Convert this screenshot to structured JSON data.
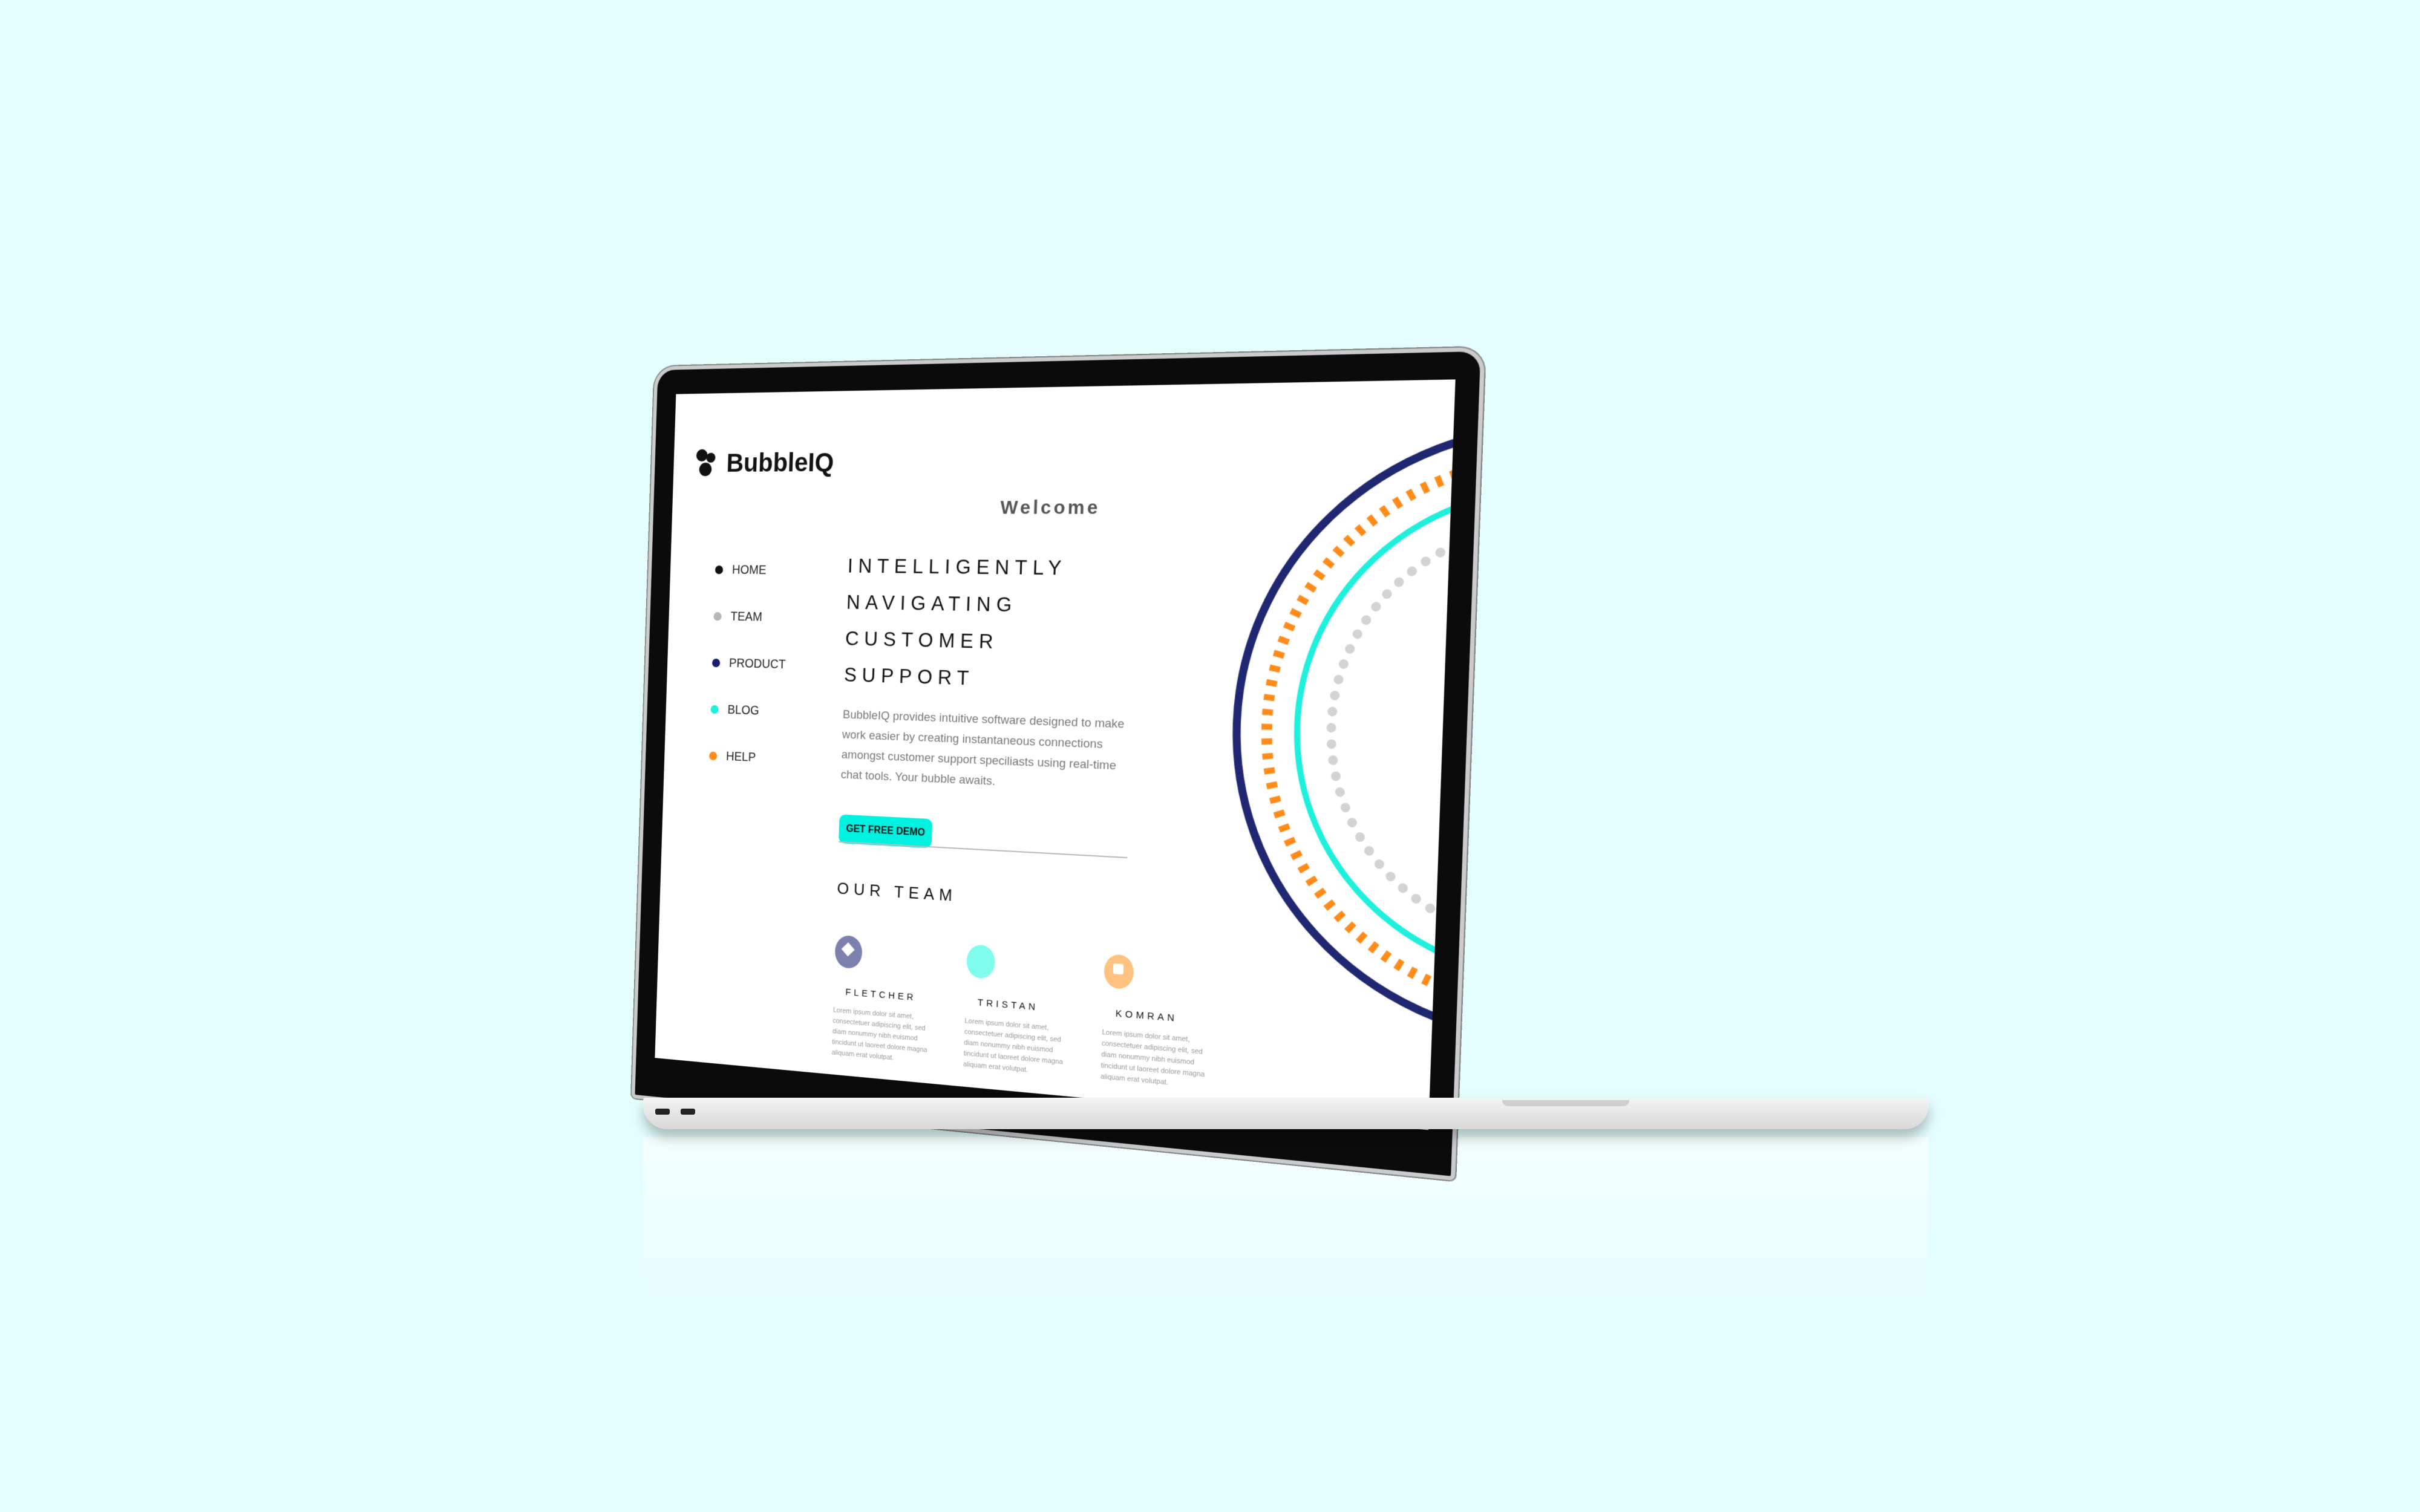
{
  "brand": {
    "name": "BubbleIQ"
  },
  "header": {
    "welcome": "Welcome"
  },
  "nav": [
    {
      "label": "HOME",
      "color": "#111111"
    },
    {
      "label": "TEAM",
      "color": "#b5b5b5"
    },
    {
      "label": "PRODUCT",
      "color": "#1a1f6b"
    },
    {
      "label": "BLOG",
      "color": "#1ff0dc"
    },
    {
      "label": "HELP",
      "color": "#ff8c1a"
    }
  ],
  "hero": {
    "line1": "INTELLIGENTLY",
    "line2": "NAVIGATING",
    "line3": "CUSTOMER SUPPORT",
    "description": "BubbleIQ provides intuitive software designed to make work easier by creating instantaneous connections amongst customer support speciliasts using real-time chat tools. Your bubble awaits.",
    "cta": "GET FREE DEMO"
  },
  "team": {
    "title": "OUR TEAM",
    "members": [
      {
        "name": "FLETCHER",
        "color": "#7c80ad",
        "bio": "Lorem ipsum dolor sit amet, consectetuer adipiscing elit, sed diam nonummy nibh euismod tincidunt ut laoreet dolore magna aliquam erat volutpat."
      },
      {
        "name": "TRISTAN",
        "color": "#7ffcec",
        "bio": "Lorem ipsum dolor sit amet, consectetuer adipiscing elit, sed diam nonummy nibh euismod tincidunt ut laoreet dolore magna aliquam erat volutpat."
      },
      {
        "name": "KOMRAN",
        "color": "#ffc27f",
        "bio": "Lorem ipsum dolor sit amet, consectetuer adipiscing elit, sed diam nonummy nibh euismod tincidunt ut laoreet dolore magna aliquam erat volutpat."
      }
    ]
  },
  "device": {
    "label": "MacBook Pro"
  },
  "colors": {
    "navy": "#1f2770",
    "turquoise": "#1ff0dc",
    "orange": "#ff8c1a",
    "grey": "#d3d3d3",
    "background": "#e3fefd"
  }
}
